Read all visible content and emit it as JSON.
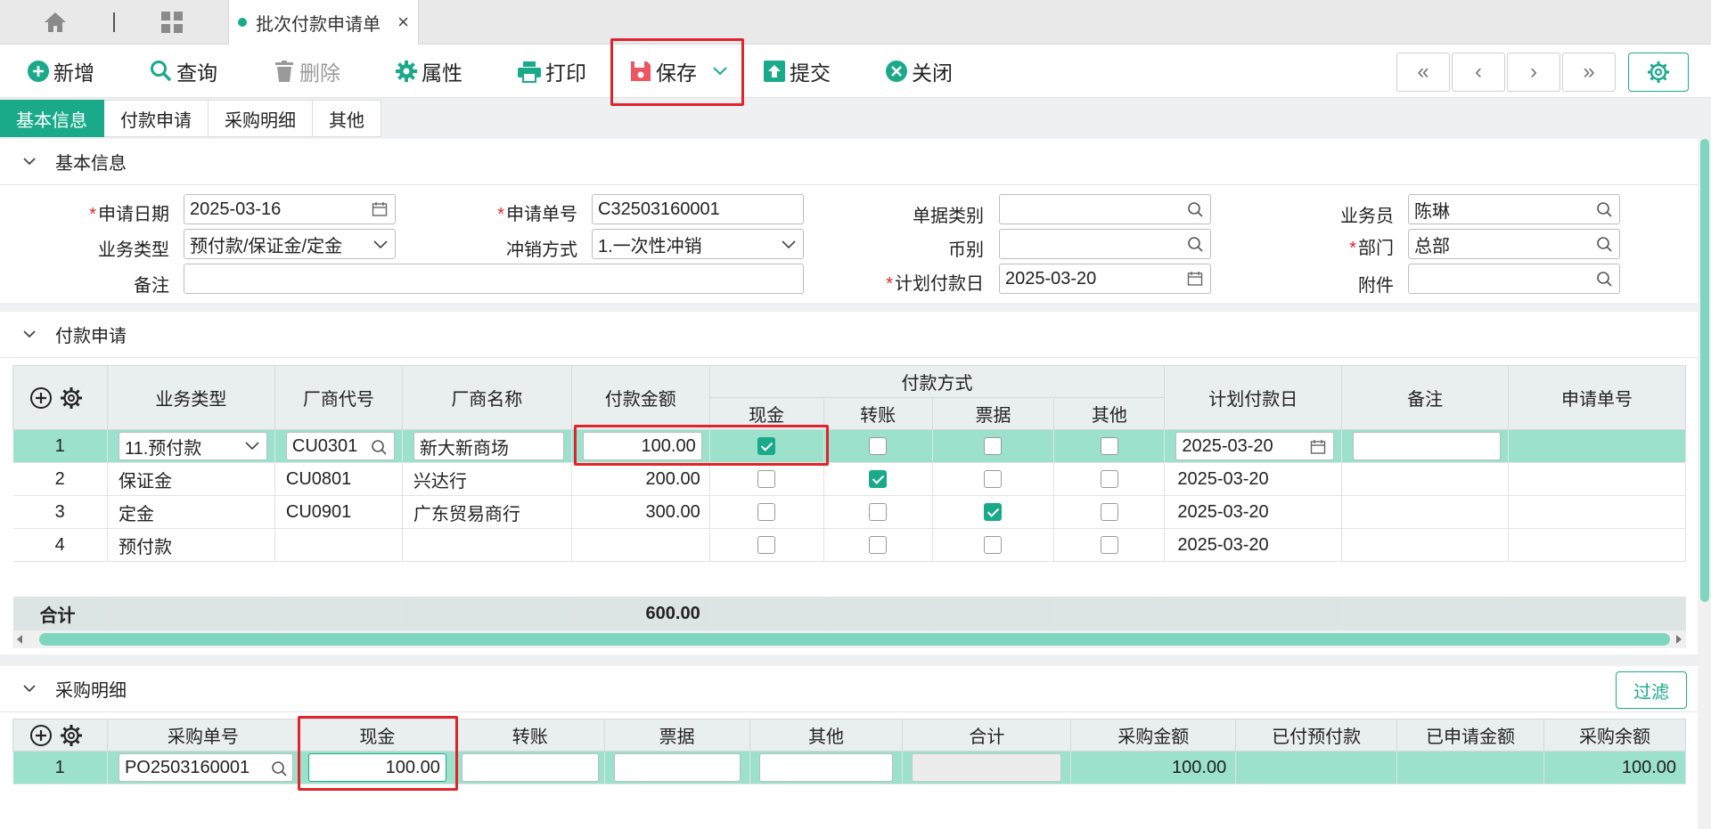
{
  "tabbar": {
    "doc_tab_label": "批次付款申请单",
    "close_glyph": "×"
  },
  "toolbar": {
    "add": "新增",
    "query": "查询",
    "delete": "删除",
    "properties": "属性",
    "print": "打印",
    "save": "保存",
    "submit": "提交",
    "close": "关闭",
    "nav": [
      "«",
      "‹",
      "›",
      "»"
    ]
  },
  "subtabs": [
    "基本信息",
    "付款申请",
    "采购明细",
    "其他"
  ],
  "basic": {
    "title": "基本信息",
    "apply_date_label": "申请日期",
    "apply_date": "2025-03-16",
    "apply_no_label": "申请单号",
    "apply_no": "C32503160001",
    "doc_type_label": "单据类别",
    "doc_type": "",
    "salesman_label": "业务员",
    "salesman": "陈琳",
    "biz_type_label": "业务类型",
    "biz_type": "预付款/保证金/定金",
    "offset_label": "冲销方式",
    "offset": "1.一次性冲销",
    "currency_label": "币别",
    "currency": "",
    "dept_label": "部门",
    "dept": "总部",
    "remark_label": "备注",
    "remark": "",
    "plan_date_label": "计划付款日",
    "plan_date": "2025-03-20",
    "attach_label": "附件",
    "attach": ""
  },
  "payment": {
    "title": "付款申请",
    "headers": {
      "biz_type": "业务类型",
      "vendor_code": "厂商代号",
      "vendor_name": "厂商名称",
      "amount": "付款金额",
      "method": "付款方式",
      "cash": "现金",
      "transfer": "转账",
      "bill": "票据",
      "other": "其他",
      "plan_date": "计划付款日",
      "remark": "备注",
      "apply_no": "申请单号"
    },
    "rows": [
      {
        "no": "1",
        "biz_type": "11.预付款",
        "vendor_code": "CU0301",
        "vendor_name": "新大新商场",
        "amount": "100.00",
        "cash": true,
        "transfer": false,
        "bill": false,
        "other": false,
        "plan_date": "2025-03-20",
        "remark": "",
        "apply_no": ""
      },
      {
        "no": "2",
        "biz_type": "保证金",
        "vendor_code": "CU0801",
        "vendor_name": "兴达行",
        "amount": "200.00",
        "cash": false,
        "transfer": true,
        "bill": false,
        "other": false,
        "plan_date": "2025-03-20",
        "remark": "",
        "apply_no": ""
      },
      {
        "no": "3",
        "biz_type": "定金",
        "vendor_code": "CU0901",
        "vendor_name": "广东贸易商行",
        "amount": "300.00",
        "cash": false,
        "transfer": false,
        "bill": true,
        "other": false,
        "plan_date": "2025-03-20",
        "remark": "",
        "apply_no": ""
      },
      {
        "no": "4",
        "biz_type": "预付款",
        "vendor_code": "",
        "vendor_name": "",
        "amount": "",
        "cash": false,
        "transfer": false,
        "bill": false,
        "other": false,
        "plan_date": "2025-03-20",
        "remark": "",
        "apply_no": ""
      }
    ],
    "total_label": "合计",
    "total_amount": "600.00"
  },
  "purchase": {
    "title": "采购明细",
    "filter": "过滤",
    "headers": {
      "po_no": "采购单号",
      "cash": "现金",
      "transfer": "转账",
      "bill": "票据",
      "other": "其他",
      "sum": "合计",
      "po_amount": "采购金额",
      "prepaid": "已付预付款",
      "applied": "已申请金额",
      "balance": "采购余额"
    },
    "rows": [
      {
        "no": "1",
        "po_no": "PO2503160001",
        "cash": "100.00",
        "transfer": "",
        "bill": "",
        "other": "",
        "sum": "",
        "po_amount": "100.00",
        "prepaid": "",
        "applied": "",
        "balance": "100.00"
      }
    ]
  },
  "colors": {
    "accent": "#1aaa8a",
    "selected_row": "#9be1cc",
    "highlight": "#e0242c"
  }
}
